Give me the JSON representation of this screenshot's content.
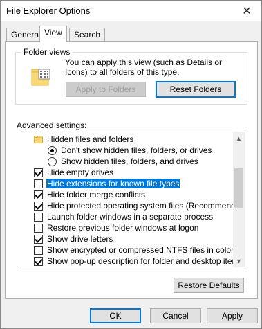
{
  "window": {
    "title": "File Explorer Options",
    "close_glyph": "✕"
  },
  "tabs": [
    {
      "label": "General",
      "active": false
    },
    {
      "label": "View",
      "active": true
    },
    {
      "label": "Search",
      "active": false
    }
  ],
  "folder_views": {
    "legend": "Folder views",
    "description": "You can apply this view (such as Details or Icons) to all folders of this type.",
    "apply_button": "Apply to Folders",
    "reset_button": "Reset Folders"
  },
  "advanced": {
    "label": "Advanced settings:",
    "items": [
      {
        "type": "folder",
        "label": "Hidden files and folders",
        "indent": 1
      },
      {
        "type": "radio",
        "label": "Don't show hidden files, folders, or drives",
        "checked": true,
        "indent": 2
      },
      {
        "type": "radio",
        "label": "Show hidden files, folders, and drives",
        "checked": false,
        "indent": 2
      },
      {
        "type": "checkbox",
        "label": "Hide empty drives",
        "checked": true,
        "indent": 0
      },
      {
        "type": "checkbox",
        "label": "Hide extensions for known file types",
        "checked": false,
        "indent": 0,
        "selected": true
      },
      {
        "type": "checkbox",
        "label": "Hide folder merge conflicts",
        "checked": true,
        "indent": 0
      },
      {
        "type": "checkbox",
        "label": "Hide protected operating system files (Recommended)",
        "checked": true,
        "indent": 0
      },
      {
        "type": "checkbox",
        "label": "Launch folder windows in a separate process",
        "checked": false,
        "indent": 0
      },
      {
        "type": "checkbox",
        "label": "Restore previous folder windows at logon",
        "checked": false,
        "indent": 0
      },
      {
        "type": "checkbox",
        "label": "Show drive letters",
        "checked": true,
        "indent": 0
      },
      {
        "type": "checkbox",
        "label": "Show encrypted or compressed NTFS files in color",
        "checked": false,
        "indent": 0
      },
      {
        "type": "checkbox",
        "label": "Show pop-up description for folder and desktop items",
        "checked": true,
        "indent": 0
      }
    ]
  },
  "restore_defaults": "Restore Defaults",
  "footer": {
    "ok": "OK",
    "cancel": "Cancel",
    "apply": "Apply"
  },
  "colors": {
    "accent": "#0078d7",
    "folder": "#f8d775"
  }
}
